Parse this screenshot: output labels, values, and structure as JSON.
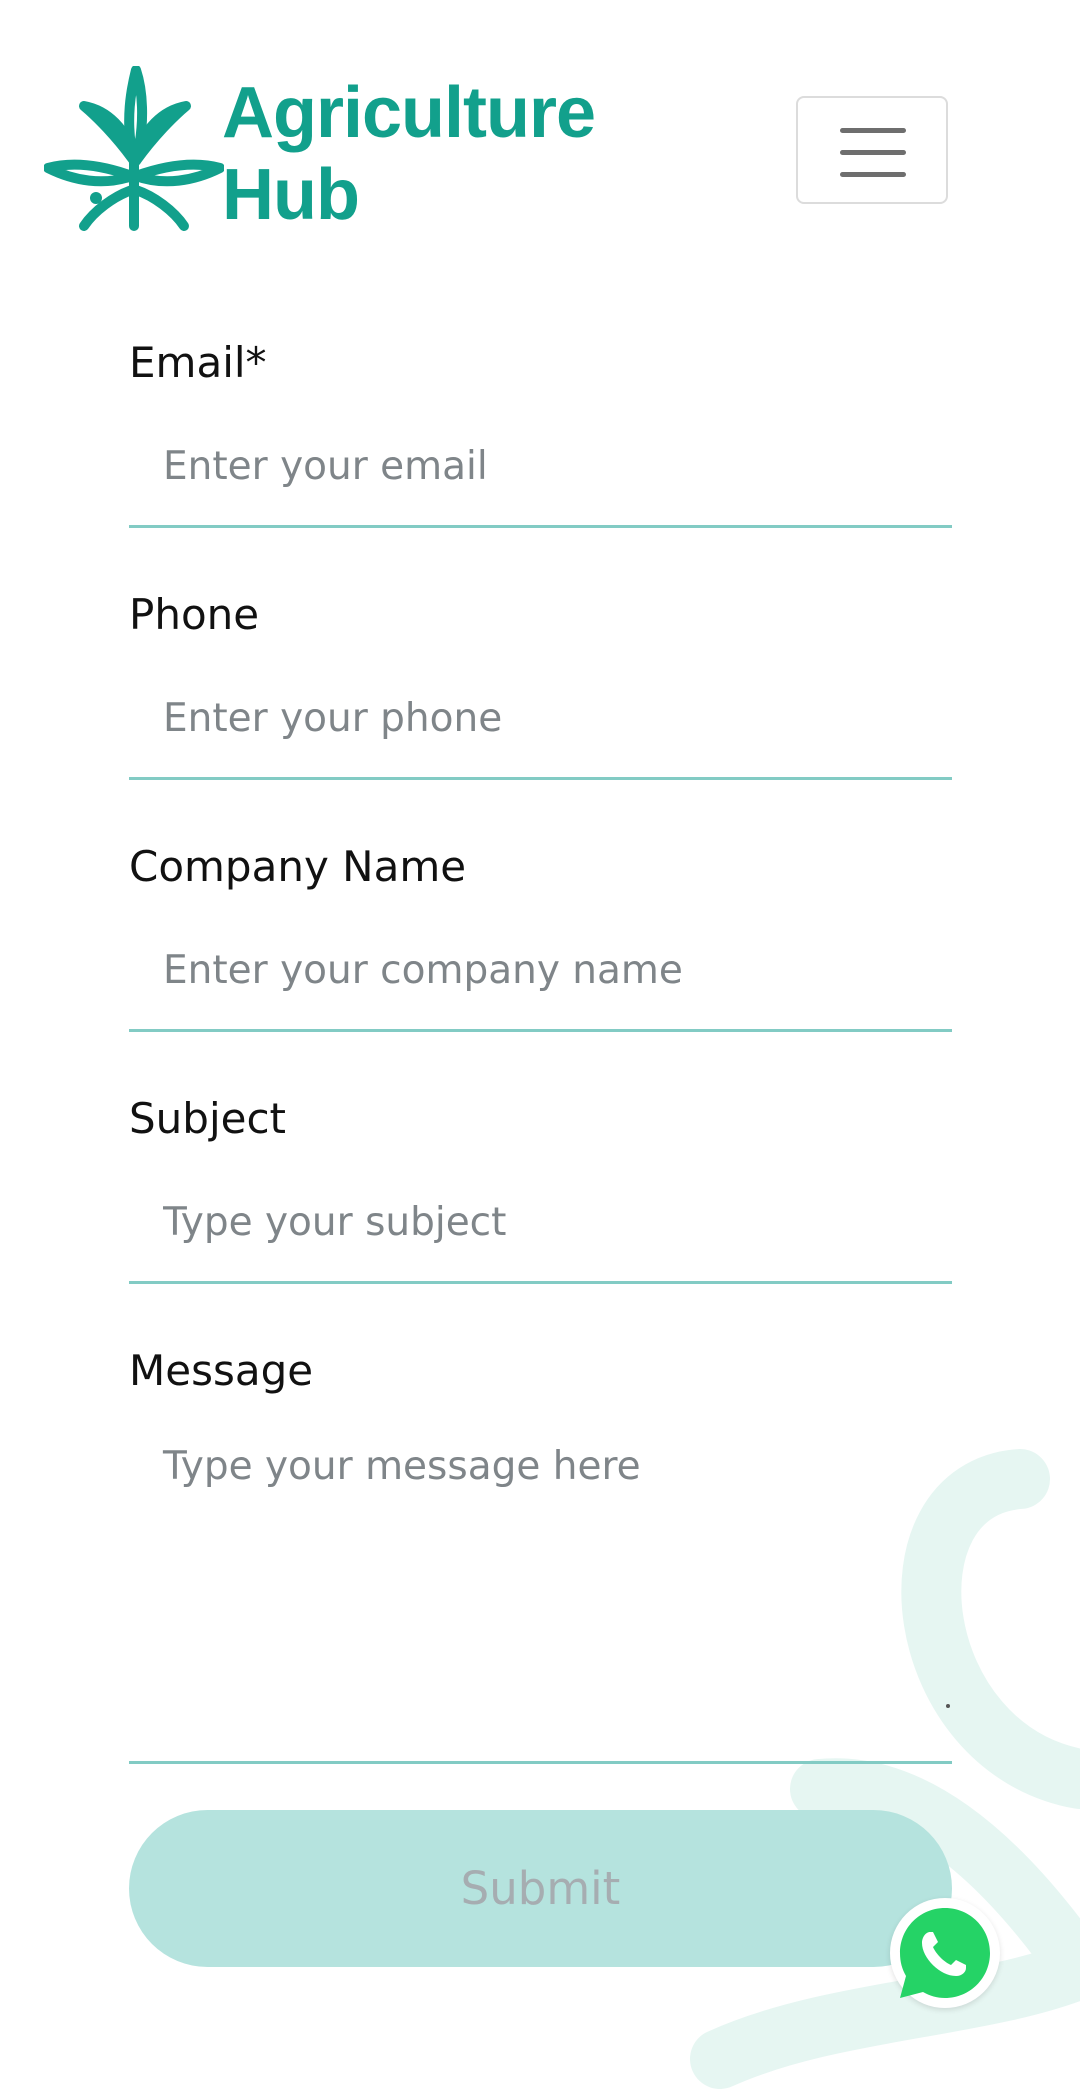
{
  "brand": {
    "line1": "Agriculture",
    "line2": "Hub",
    "color": "#12a08c",
    "icon": "leaf-burst-logo-icon"
  },
  "menu": {
    "icon": "hamburger-menu-icon"
  },
  "form": {
    "email": {
      "label": "Email*",
      "placeholder": "Enter your email"
    },
    "phone": {
      "label": "Phone",
      "placeholder": "Enter your phone"
    },
    "company": {
      "label": "Company Name",
      "placeholder": "Enter your company name"
    },
    "subject": {
      "label": "Subject",
      "placeholder": "Type your subject"
    },
    "message": {
      "label": "Message",
      "placeholder": "Type your message here"
    },
    "submit_label": "Submit"
  },
  "colors": {
    "accent_line": "#82cbc4",
    "submit_bg": "#b5e3de",
    "whatsapp": "#25d366"
  },
  "whatsapp": {
    "icon": "whatsapp-icon"
  }
}
